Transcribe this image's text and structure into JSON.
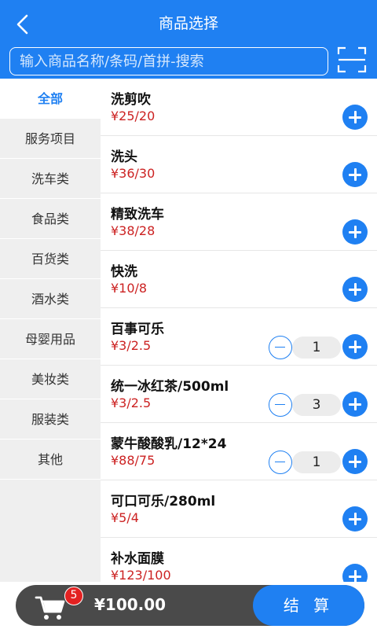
{
  "header": {
    "title": "商品选择",
    "search_placeholder": "输入商品名称/条码/首拼-搜索"
  },
  "icons": {
    "back": "chevron-left-icon",
    "scan": "scan-icon",
    "cart": "shopping-cart-icon"
  },
  "colors": {
    "primary": "#1f80f2",
    "price": "#cc2222",
    "badge": "#e32121",
    "cart_bar": "#4a4a4a"
  },
  "categories": [
    {
      "label": "全部",
      "active": true
    },
    {
      "label": "服务项目",
      "active": false
    },
    {
      "label": "洗车类",
      "active": false
    },
    {
      "label": "食品类",
      "active": false
    },
    {
      "label": "百货类",
      "active": false
    },
    {
      "label": "酒水类",
      "active": false
    },
    {
      "label": "母婴用品",
      "active": false
    },
    {
      "label": "美妆类",
      "active": false
    },
    {
      "label": "服装类",
      "active": false
    },
    {
      "label": "其他",
      "active": false
    }
  ],
  "products": [
    {
      "name": "洗剪吹",
      "price": "¥25/20",
      "qty": null
    },
    {
      "name": "洗头",
      "price": "¥36/30",
      "qty": null
    },
    {
      "name": "精致洗车",
      "price": "¥38/28",
      "qty": null
    },
    {
      "name": "快洗",
      "price": "¥10/8",
      "qty": null
    },
    {
      "name": "百事可乐",
      "price": "¥3/2.5",
      "qty": "1"
    },
    {
      "name": "统一冰红茶/500ml",
      "price": "¥3/2.5",
      "qty": "3"
    },
    {
      "name": "蒙牛酸酸乳/12*24",
      "price": "¥88/75",
      "qty": "1"
    },
    {
      "name": "可口可乐/280ml",
      "price": "¥5/4",
      "qty": null
    },
    {
      "name": "补水面膜",
      "price": "¥123/100",
      "qty": null
    }
  ],
  "cart": {
    "count": "5",
    "total": "¥100.00",
    "checkout_label": "结 算"
  }
}
